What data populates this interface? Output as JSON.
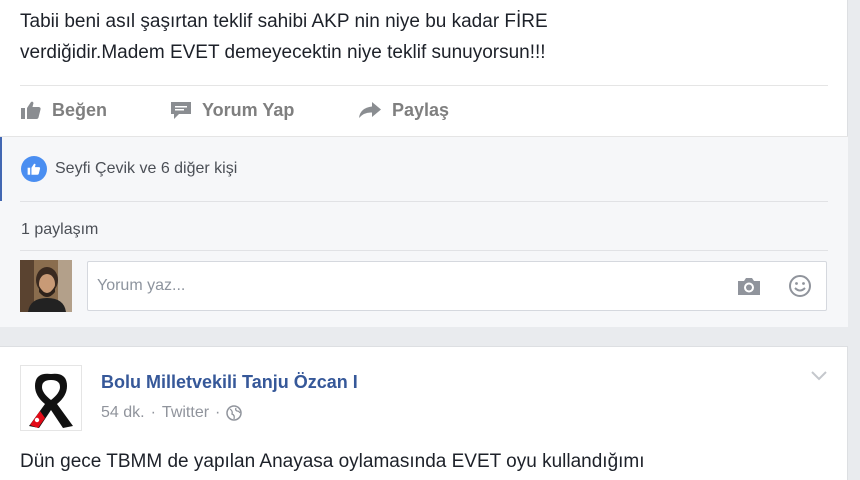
{
  "post1": {
    "text_lines": [
      "Tabii beni asıl şaşırtan teklif sahibi AKP nin niye bu kadar FİRE",
      "verdiğidir.Madem EVET demeyecektin niye teklif sunuyorsun!!!"
    ],
    "actions": {
      "like_label": "Beğen",
      "comment_label": "Yorum Yap",
      "share_label": "Paylaş"
    },
    "likes_text": "Seyfi Çevik ve 6 diğer kişi",
    "shares_text": "1 paylaşım",
    "comment_placeholder": "Yorum yaz..."
  },
  "post2": {
    "author": "Bolu Milletvekili Tanju Özcan I",
    "time": "54 dk.",
    "separator": "·",
    "source": "Twitter",
    "text_line": "Dün gece TBMM de yapılan Anayasa oylamasında EVET oyu kullandığımı"
  },
  "icons": {
    "like": "thumbs-up-icon",
    "comment": "comment-bubble-icon",
    "share": "share-arrow-icon",
    "camera": "camera-icon",
    "emoji": "emoji-icon",
    "globe": "globe-icon",
    "chevron": "chevron-down-icon"
  },
  "colors": {
    "link": "#365899",
    "like_blue": "#4a8ef1",
    "action_gray": "#7f7f7f"
  }
}
